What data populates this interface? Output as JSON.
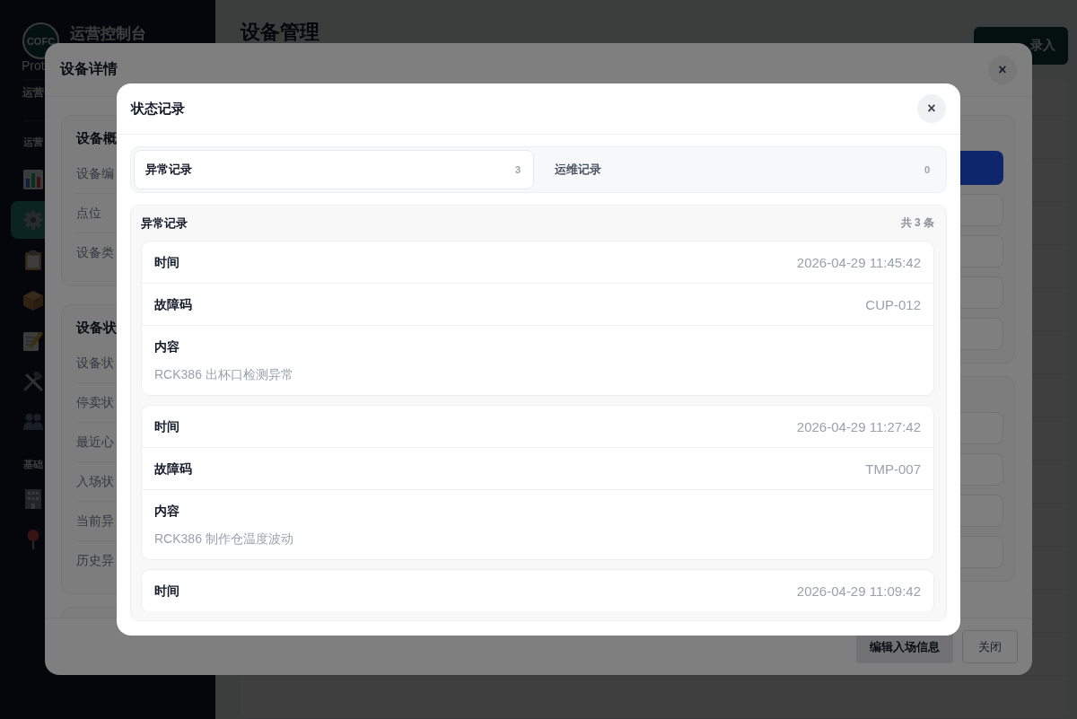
{
  "sidebar": {
    "logo": "COFC",
    "title": "运营控制台",
    "subtitle": "Prot",
    "user_role": "运营",
    "sections": [
      {
        "title": "运营",
        "items": [
          {
            "selected": false
          },
          {
            "selected": true
          },
          {
            "selected": false
          },
          {
            "selected": false
          },
          {
            "selected": false
          },
          {
            "selected": false
          },
          {
            "selected": false
          }
        ]
      },
      {
        "title": "基础",
        "items": [
          {
            "selected": false
          },
          {
            "selected": false
          }
        ]
      }
    ]
  },
  "page": {
    "title": "设备管理",
    "primary_button": "录入"
  },
  "detail_dialog": {
    "title": "设备详情",
    "close": "×",
    "sections": [
      {
        "title": "设备概",
        "rows": [
          "设备编",
          "点位",
          "设备类"
        ]
      },
      {
        "title": "设备状",
        "rows": [
          "设备状",
          "停卖状",
          "最近心",
          "入场状",
          "当前异",
          "历史异"
        ]
      }
    ],
    "footer_buttons": [
      {
        "label": "编辑入场信息",
        "kind": "secondary"
      },
      {
        "label": "关闭",
        "kind": "outline"
      }
    ]
  },
  "records_dialog": {
    "title": "状态记录",
    "close": "×",
    "tabs": [
      {
        "label": "异常记录",
        "count": "3",
        "selected": true
      },
      {
        "label": "运维记录",
        "count": "0",
        "selected": false
      }
    ],
    "panel": {
      "title": "异常记录",
      "total": "共 3 条",
      "records": [
        {
          "rows": [
            {
              "kind": "inline",
              "label": "时间",
              "value": "2026-04-29 11:45:42"
            },
            {
              "kind": "inline",
              "label": "故障码",
              "value": "CUP-012"
            },
            {
              "kind": "block",
              "label": "内容",
              "value": "RCK386 出杯口检测异常"
            }
          ]
        },
        {
          "rows": [
            {
              "kind": "inline",
              "label": "时间",
              "value": "2026-04-29 11:27:42"
            },
            {
              "kind": "inline",
              "label": "故障码",
              "value": "TMP-007"
            },
            {
              "kind": "block",
              "label": "内容",
              "value": "RCK386 制作仓温度波动"
            }
          ]
        },
        {
          "rows": [
            {
              "kind": "inline",
              "label": "时间",
              "value": "2026-04-29 11:09:42"
            }
          ]
        }
      ]
    }
  }
}
